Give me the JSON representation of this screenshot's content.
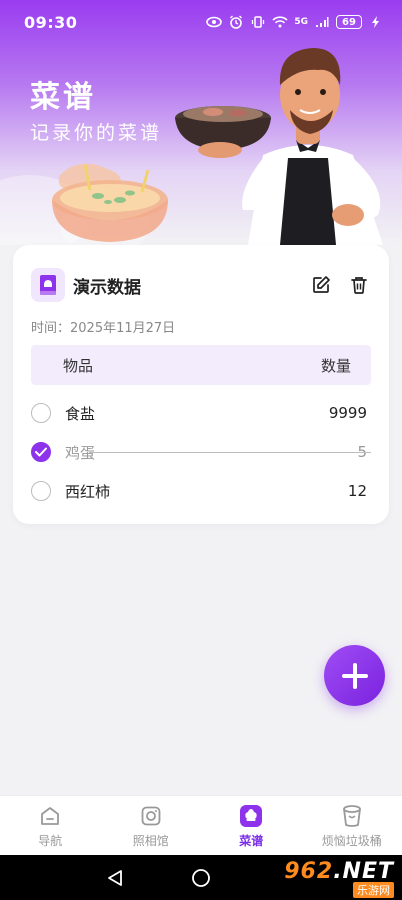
{
  "status_bar": {
    "time": "09:30",
    "network": "5G",
    "battery": "69"
  },
  "hero": {
    "title": "菜谱",
    "subtitle": "记录你的菜谱"
  },
  "recipe": {
    "title": "演示数据",
    "date": "时间：2025年11月27日",
    "columns": {
      "item": "物品",
      "quantity": "数量"
    },
    "items": [
      {
        "name": "食盐",
        "qty": "9999",
        "checked": false
      },
      {
        "name": "鸡蛋",
        "qty": "5",
        "checked": true
      },
      {
        "name": "西红柿",
        "qty": "12",
        "checked": false
      }
    ]
  },
  "nav": {
    "items": [
      {
        "label": "导航",
        "icon": "home-icon",
        "active": false
      },
      {
        "label": "照相馆",
        "icon": "camera-icon",
        "active": false
      },
      {
        "label": "菜谱",
        "icon": "chef-hat-icon",
        "active": true
      },
      {
        "label": "烦恼垃圾桶",
        "icon": "trash-bin-icon",
        "active": false
      }
    ]
  },
  "watermark": {
    "main_a": "962",
    "main_b": ".NET",
    "sub": "乐游网"
  },
  "colors": {
    "accent": "#8d33ec",
    "header_top": "#9a3cf0",
    "table_head": "#f3ecfd"
  }
}
